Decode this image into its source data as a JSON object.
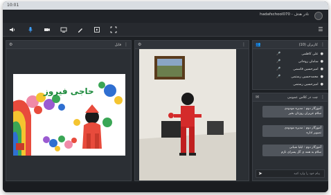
{
  "browser": {
    "clock": "10:01",
    "url": ""
  },
  "header": {
    "title": "hadafschool070 - نادر هدف"
  },
  "toolbar": {
    "tools": [
      "speaker-icon",
      "mic-icon",
      "camera-icon",
      "screen-share-icon",
      "draw-icon",
      "media-icon",
      "fullscreen-icon"
    ],
    "menu_icon": "☰"
  },
  "slide_panel": {
    "title": "فایل",
    "slide_heading": "حاجی فیروز"
  },
  "video_panel": {
    "title": ""
  },
  "users_panel": {
    "title": "کاربران (10)",
    "users": [
      "علی کاظمی",
      "سامان روحانی",
      "امیرحسین قاسمی",
      "محمدحسین رستمی",
      "امیرحسین رستمی"
    ]
  },
  "chat_panel": {
    "title": "چت در کلاس عمومی",
    "messages": [
      {
        "author": "آموزگار دوم : مدیره مودودی",
        "text": "سلام عزیزان روزتان بخیر"
      },
      {
        "author": "آموزگار دوم : مدیره مودودی",
        "text": "تصویر اداره"
      },
      {
        "author": "آموزگار دوم : ایلیا شیانی",
        "text": "سلام به همه ی گل پسرای نازم"
      }
    ],
    "input_placeholder": "پیام خود را وارد کنید",
    "send_icon": "send-icon"
  },
  "bottom": {
    "label": ""
  },
  "colors": {
    "bg": "#202328",
    "panel": "#2b2f34",
    "slide_title": "#1c8a3c"
  }
}
